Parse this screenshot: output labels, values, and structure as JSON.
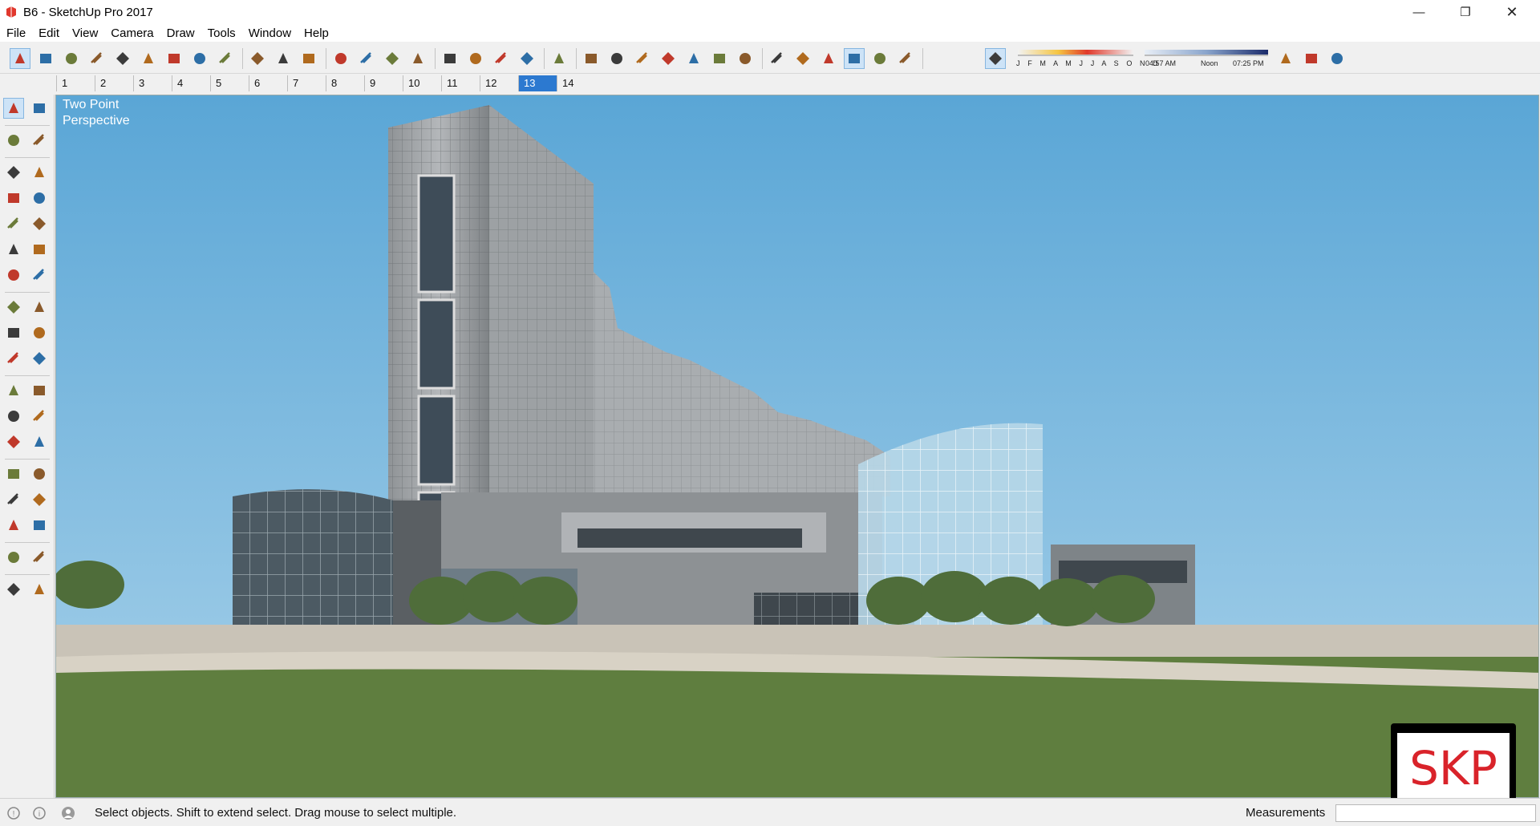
{
  "window": {
    "title": "B6 - SketchUp Pro 2017",
    "icons": {
      "app": "sketchup-icon",
      "minimize": "minimize-icon",
      "restore": "restore-icon",
      "close": "close-icon"
    }
  },
  "menu": [
    "File",
    "Edit",
    "View",
    "Camera",
    "Draw",
    "Tools",
    "Window",
    "Help"
  ],
  "toolbar": {
    "tools": [
      "select-arrow-icon",
      "eraser-icon",
      "pencil-line-icon",
      "arc-icon",
      "rectangle-icon",
      "push-pull-icon",
      "follow-me-icon",
      "move-icon",
      "rotate-icon",
      "scale-icon",
      "tape-measure-icon",
      "text-icon",
      "paint-bucket-icon",
      "orbit-icon",
      "pan-icon",
      "zoom-icon",
      "zoom-extents-icon",
      "3d-warehouse-icon",
      "share-model-icon",
      "extension-warehouse-icon",
      "ruby-icon",
      "iso-view-icon",
      "top-view-icon",
      "front-view-icon",
      "right-view-icon",
      "back-view-icon",
      "left-view-icon",
      "xray-icon",
      "back-edges-icon",
      "wireframe-icon",
      "hidden-line-icon",
      "shaded-icon",
      "shaded-textures-icon",
      "monochrome-icon",
      "shadows-toggle-icon",
      "add-location-icon",
      "toggle-terrain-icon",
      "get-models-icon"
    ],
    "month_labels": "J F M A M J J A S O N D",
    "time_start": "04:57 AM",
    "time_mid": "Noon",
    "time_end": "07:25 PM"
  },
  "scenes": [
    "1",
    "2",
    "3",
    "4",
    "5",
    "6",
    "7",
    "8",
    "9",
    "10",
    "11",
    "12",
    "13",
    "14"
  ],
  "active_scene": "13",
  "left_tools": [
    "select-icon",
    "component-icon",
    "paint-bucket-icon",
    "eraser-icon",
    "line-icon",
    "freehand-icon",
    "rectangle-icon",
    "rotated-rectangle-icon",
    "circle-icon",
    "polygon-icon",
    "arc-icon",
    "two-point-arc-icon",
    "three-point-arc-icon",
    "pie-icon",
    "move-icon",
    "push-pull-icon",
    "rotate-icon",
    "follow-me-icon",
    "scale-icon",
    "offset-icon",
    "tape-measure-icon",
    "dimension-icon",
    "protractor-icon",
    "text-icon",
    "axes-icon",
    "3d-text-icon",
    "orbit-icon",
    "pan-icon",
    "zoom-icon",
    "zoom-window-icon",
    "zoom-extents-icon",
    "previous-view-icon",
    "position-camera-icon",
    "look-around-icon",
    "walk-icon",
    "section-plane-icon"
  ],
  "viewport": {
    "camera_label": "Two Point\nPerspective",
    "sky_top": "#5aa6d6",
    "sky_bottom": "#a9d2ea"
  },
  "status": {
    "message": "Select objects. Shift to extend select. Drag mouse to select multiple.",
    "measurements_label": "Measurements",
    "icons": [
      "geo-location-icon",
      "credits-icon",
      "user-account-icon"
    ]
  },
  "badge": {
    "text": "SKP"
  }
}
